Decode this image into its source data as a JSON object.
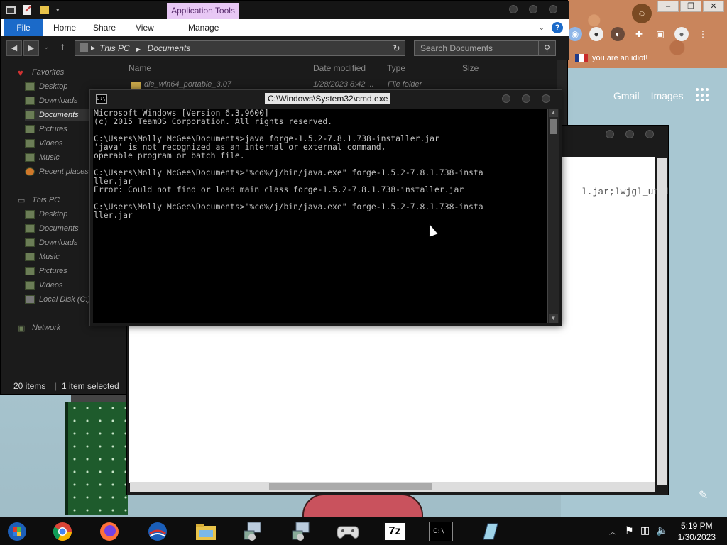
{
  "explorer": {
    "app_tools": "Application Tools",
    "tabs": {
      "file": "File",
      "home": "Home",
      "share": "Share",
      "view": "View",
      "manage": "Manage"
    },
    "address": {
      "this_pc": "This PC",
      "documents": "Documents"
    },
    "search_placeholder": "Search Documents",
    "columns": {
      "name": "Name",
      "date": "Date modified",
      "type": "Type",
      "size": "Size"
    },
    "first_row": {
      "name": "dle_win64_portable_3.07",
      "date": "1/28/2023 8:42 ...",
      "type": "File folder"
    },
    "nav": {
      "favorites": "Favorites",
      "fav_items": [
        "Desktop",
        "Downloads",
        "Documents",
        "Pictures",
        "Videos",
        "Music",
        "Recent places"
      ],
      "this_pc": "This PC",
      "pc_items": [
        "Desktop",
        "Documents",
        "Downloads",
        "Music",
        "Pictures",
        "Videos",
        "Local Disk (C:)"
      ],
      "network": "Network"
    },
    "status": {
      "items": "20 items",
      "selected": "1 item selected"
    }
  },
  "cmd": {
    "title": "C:\\Windows\\System32\\cmd.exe",
    "lines": [
      "Microsoft Windows [Version 6.3.9600]",
      "(c) 2015 TeamOS Corporation. All rights reserved.",
      "",
      "C:\\Users\\Molly McGee\\Documents>java forge-1.5.2-7.8.1.738-installer.jar",
      "'java' is not recognized as an internal or external command,",
      "operable program or batch file.",
      "",
      "C:\\Users\\Molly McGee\\Documents>\"%cd%/j/bin/java.exe\" forge-1.5.2-7.8.1.738-insta",
      "ller.jar",
      "Error: Could not find or load main class forge-1.5.2-7.8.1.738-installer.jar",
      "",
      "C:\\Users\\Molly McGee\\Documents>\"%cd%/j/bin/java.exe\" forge-1.5.2-7.8.1.738-insta",
      "ller.jar"
    ]
  },
  "notepad": {
    "visible_text": "l.jar;lwjgl_util"
  },
  "browser": {
    "bookmark": "you are an idiot!",
    "gmail": "Gmail",
    "images": "Images"
  },
  "taskbar": {
    "apps": [
      "windows-explorer-icon",
      "chrome-icon",
      "firefox-icon",
      "obama-icon",
      "file-explorer-icon",
      "installer-icon",
      "installer2-icon",
      "gamepad-icon",
      "7zip-icon",
      "cmd-icon",
      "notepad-icon"
    ],
    "zip_label": "7z",
    "time": "5:19 PM",
    "date": "1/30/2023"
  }
}
